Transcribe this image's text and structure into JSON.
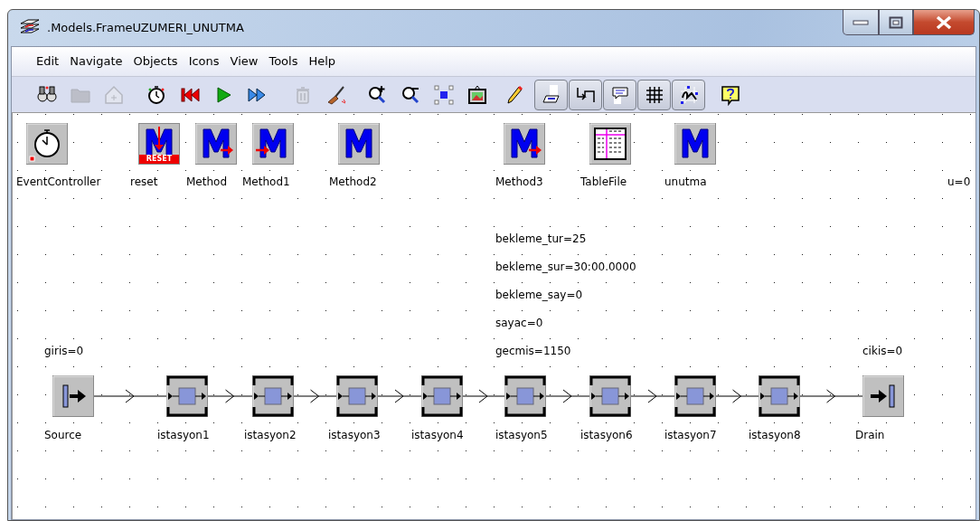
{
  "window": {
    "title": ".Models.FrameUZUMERI_UNUTMA"
  },
  "menu": [
    "Edit",
    "Navigate",
    "Objects",
    "Icons",
    "View",
    "Tools",
    "Help"
  ],
  "toolbar": [
    {
      "kind": "binoculars",
      "disabled": false
    },
    {
      "kind": "folder",
      "disabled": true
    },
    {
      "kind": "home",
      "disabled": true
    },
    {
      "kind": "stopwatch",
      "disabled": false
    },
    {
      "kind": "rewind",
      "disabled": false
    },
    {
      "kind": "play",
      "disabled": false
    },
    {
      "kind": "forward",
      "disabled": false
    },
    {
      "kind": "trash",
      "disabled": true
    },
    {
      "kind": "broom",
      "disabled": false
    },
    {
      "kind": "zoomin",
      "disabled": false
    },
    {
      "kind": "zoomout",
      "disabled": false
    },
    {
      "kind": "select",
      "disabled": false
    },
    {
      "kind": "image",
      "disabled": false
    },
    {
      "kind": "pencil",
      "disabled": false
    }
  ],
  "toggles": [
    {
      "kind": "display",
      "pressed": true
    },
    {
      "kind": "connector",
      "pressed": true
    },
    {
      "kind": "comment",
      "pressed": true
    },
    {
      "kind": "grid",
      "pressed": true
    },
    {
      "kind": "snap",
      "pressed": true
    }
  ],
  "objects": [
    {
      "kind": "clock",
      "label": "EventController"
    },
    {
      "kind": "reset",
      "label": "reset",
      "badge": "RESET"
    },
    {
      "kind": "method-out",
      "label": "Method"
    },
    {
      "kind": "method-in",
      "label": "Method1"
    },
    {
      "kind": "method",
      "label": "Method2"
    },
    {
      "kind": "method-out",
      "label": "Method3"
    },
    {
      "kind": "table",
      "label": "TableFile"
    },
    {
      "kind": "method",
      "label": "unutma"
    }
  ],
  "variables": [
    "u=0",
    "bekleme_tur=25",
    "bekleme_sur=30:00.0000",
    "bekleme_say=0",
    "sayac=0",
    "giris=0",
    "gecmis=1150",
    "cikis=0"
  ],
  "flow": [
    {
      "kind": "source",
      "label": "Source"
    },
    {
      "kind": "station",
      "label": "istasyon1"
    },
    {
      "kind": "station",
      "label": "istasyon2"
    },
    {
      "kind": "station",
      "label": "istasyon3"
    },
    {
      "kind": "station",
      "label": "istasyon4"
    },
    {
      "kind": "station",
      "label": "istasyon5"
    },
    {
      "kind": "station",
      "label": "istasyon6"
    },
    {
      "kind": "station",
      "label": "istasyon7"
    },
    {
      "kind": "station",
      "label": "istasyon8"
    },
    {
      "kind": "drain",
      "label": "Drain"
    }
  ]
}
